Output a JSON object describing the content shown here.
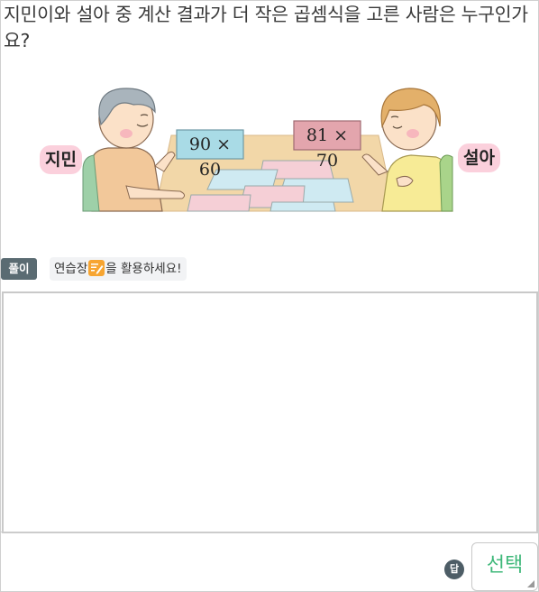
{
  "question": {
    "text": "지민이와 설아 중 계산 결과가 더 작은 곱셈식을 고른 사람은 누구인가요?"
  },
  "illustration": {
    "left_person": {
      "name": "지민",
      "card": "90 × 60"
    },
    "right_person": {
      "name": "설아",
      "card": "81 × 70"
    }
  },
  "solution": {
    "tag": "풀이",
    "hint_before": "연습장",
    "hint_after": "을 활용하세요!",
    "hint_icon": "notepad-icon"
  },
  "answer": {
    "tag": "답",
    "button_label": "선택"
  },
  "colors": {
    "accent_green": "#3fb87a",
    "tag_bg": "#5a6b72",
    "badge_pink": "#fbd0dc",
    "card_blue": "#a9dbe6",
    "card_pink": "#e3a5ad",
    "notepad_orange": "#f7a531"
  }
}
